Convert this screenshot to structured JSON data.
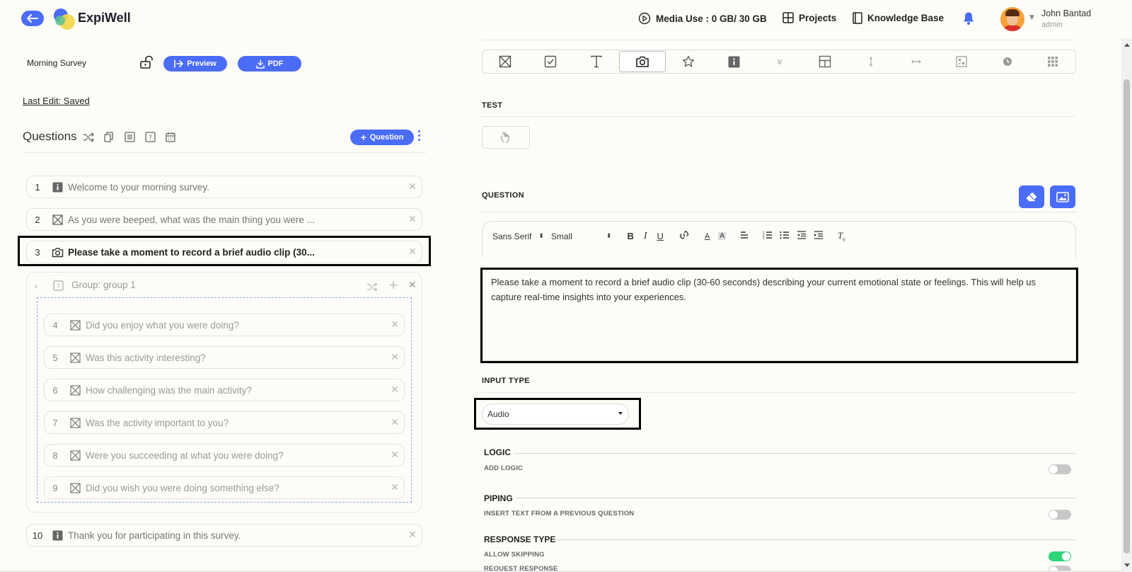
{
  "brand": "ExpiWell",
  "nav": {
    "media_use": "Media Use : 0 GB/ 30 GB",
    "projects": "Projects",
    "knowledge_base": "Knowledge Base"
  },
  "user": {
    "name": "John Bantad",
    "role": "admin"
  },
  "survey": {
    "name": "Morning Survey",
    "preview_label": "Preview",
    "pdf_label": "PDF",
    "last_edit": "Last Edit: Saved"
  },
  "questions_panel": {
    "title": "Questions",
    "add_label": "Question",
    "items": [
      {
        "num": "1",
        "icon": "info-icon",
        "text": "Welcome to your morning survey."
      },
      {
        "num": "2",
        "icon": "multiple-choice-icon",
        "text": "As you were beeped, what was the main thing you were ..."
      },
      {
        "num": "3",
        "icon": "camera-icon",
        "text": "Please take a moment to record a brief audio clip (30..."
      }
    ],
    "group": {
      "label": "Group: group 1",
      "items": [
        {
          "num": "4",
          "icon": "multiple-choice-icon",
          "text": "Did you enjoy what you were doing?"
        },
        {
          "num": "5",
          "icon": "multiple-choice-icon",
          "text": "Was this activity interesting?"
        },
        {
          "num": "6",
          "icon": "multiple-choice-icon",
          "text": "How challenging was the main activity?"
        },
        {
          "num": "7",
          "icon": "multiple-choice-icon",
          "text": "Was the activity important to you?"
        },
        {
          "num": "8",
          "icon": "multiple-choice-icon",
          "text": "Were you succeeding at what you were doing?"
        },
        {
          "num": "9",
          "icon": "multiple-choice-icon",
          "text": "Did you wish you were doing something else?"
        }
      ]
    },
    "last_item": {
      "num": "10",
      "icon": "info-icon",
      "text": "Thank you for participating in this survey."
    }
  },
  "editor": {
    "test_label": "TEST",
    "question_label": "QUESTION",
    "font_family": "Sans Serif",
    "font_size": "Small",
    "question_text": "Please take a moment to record a brief audio clip (30-60 seconds) describing your current emotional state or feelings. This will help us capture real-time insights into your experiences.",
    "input_type_label": "INPUT TYPE",
    "input_type_value": "Audio",
    "logic": {
      "title": "LOGIC",
      "sub": "ADD LOGIC",
      "on": false
    },
    "piping": {
      "title": "PIPING",
      "sub": "INSERT TEXT FROM A PREVIOUS QUESTION",
      "on": false
    },
    "response_type": {
      "title": "RESPONSE TYPE",
      "allow_skipping": "ALLOW SKIPPING",
      "allow_on": true,
      "request_response": "REQUEST RESPONSE",
      "request_on": false
    }
  },
  "colors": {
    "accent": "#4a6cf7",
    "toggle_on": "#2ed47a",
    "background": "#fdfcf7"
  }
}
